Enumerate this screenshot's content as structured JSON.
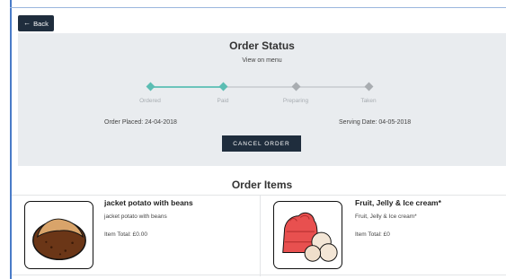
{
  "header": {
    "back_label": "Back"
  },
  "status": {
    "title": "Order Status",
    "view_on_menu": "View on menu",
    "steps": [
      {
        "label": "Ordered",
        "state": "done"
      },
      {
        "label": "Paid",
        "state": "done"
      },
      {
        "label": "Preparing",
        "state": "todo"
      },
      {
        "label": "Taken",
        "state": "todo"
      }
    ],
    "order_placed": "Order Placed: 24-04-2018",
    "serving_date": "Serving Date: 04-05-2018",
    "cancel_label": "CANCEL ORDER",
    "colors": {
      "progress_done": "#5bbdb3",
      "progress_todo": "#a9adb1",
      "button_bg": "#1f2d3d"
    }
  },
  "items": {
    "title": "Order Items",
    "list": [
      {
        "name": "jacket potato with beans",
        "description": "jacket potato with beans",
        "total": "Item Total: £0.00",
        "image_icon": "jacket-potato-icon"
      },
      {
        "name": "Fruit, Jelly & Ice cream*",
        "description": "Fruit, Jelly & Ice cream*",
        "total": "Item Total: £0",
        "image_icon": "jelly-ice-cream-icon"
      }
    ]
  }
}
